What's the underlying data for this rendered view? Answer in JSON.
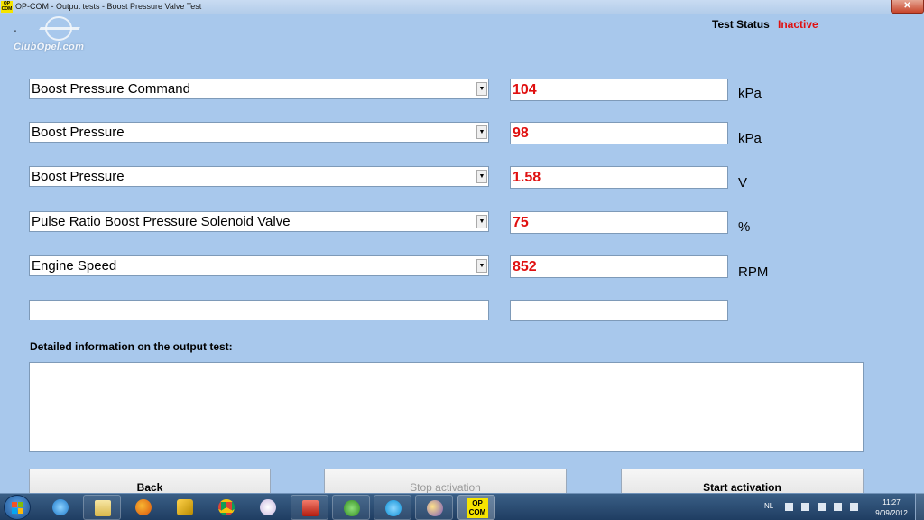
{
  "window": {
    "app_icon_text": "OP COM",
    "title": "OP-COM - Output tests - Boost Pressure Valve Test",
    "close_glyph": "✕"
  },
  "logo": {
    "dash": "-",
    "text": "ClubOpel.com"
  },
  "status": {
    "label": "Test Status",
    "value": "Inactive"
  },
  "rows": [
    {
      "parameter": "Boost Pressure Command",
      "value": "104",
      "unit": "kPa"
    },
    {
      "parameter": "Boost Pressure",
      "value": "98",
      "unit": "kPa"
    },
    {
      "parameter": "Boost Pressure",
      "value": "1.58",
      "unit": "V"
    },
    {
      "parameter": "Pulse Ratio Boost Pressure Solenoid Valve",
      "value": "75",
      "unit": "%"
    },
    {
      "parameter": "Engine Speed",
      "value": "852",
      "unit": "RPM"
    },
    {
      "parameter": "",
      "value": "",
      "unit": ""
    }
  ],
  "details": {
    "label": "Detailed information on the output test:",
    "content": ""
  },
  "buttons": {
    "back": "Back",
    "stop": "Stop activation",
    "start": "Start activation"
  },
  "taskbar": {
    "opcom_label": "OP COM",
    "language": "NL",
    "time": "11:27",
    "date": "9/09/2012",
    "pinned_icons": [
      "ie-icon",
      "explorer-icon",
      "firefox-icon",
      "tool-icon",
      "chrome-icon",
      "paint-icon",
      "media-icon",
      "utorrent-icon",
      "skype-icon",
      "messenger-icon"
    ]
  },
  "colors": {
    "background": "#a8c8ec",
    "value_red": "#e01010",
    "status_red": "#e01010",
    "opcom_yellow": "#f6e400"
  }
}
